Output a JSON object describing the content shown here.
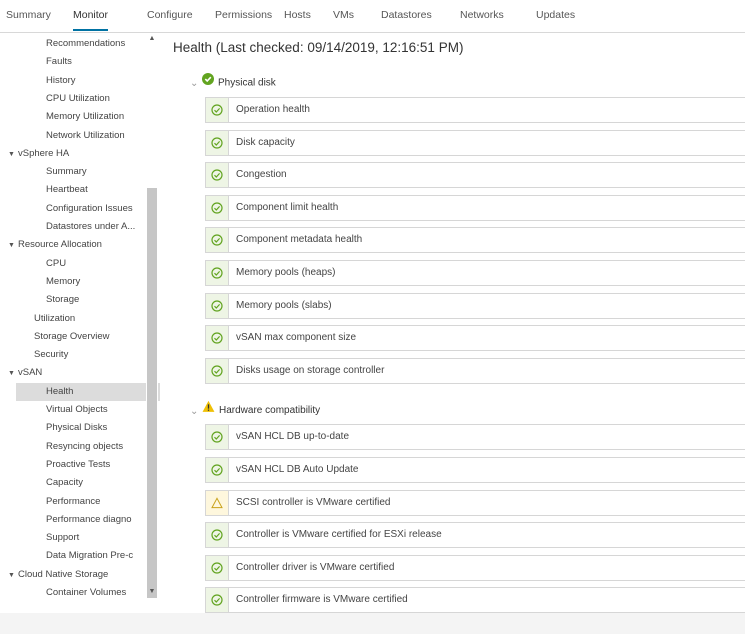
{
  "tabs": [
    "Summary",
    "Monitor",
    "Configure",
    "Permissions",
    "Hosts",
    "VMs",
    "Datastores",
    "Networks",
    "Updates"
  ],
  "active_tab": "Monitor",
  "sidebar": {
    "items": [
      {
        "label": "Recommendations",
        "level": 2,
        "caret": ""
      },
      {
        "label": "Faults",
        "level": 2,
        "caret": ""
      },
      {
        "label": "History",
        "level": 2,
        "caret": ""
      },
      {
        "label": "CPU Utilization",
        "level": 2,
        "caret": ""
      },
      {
        "label": "Memory Utilization",
        "level": 2,
        "caret": ""
      },
      {
        "label": "Network Utilization",
        "level": 2,
        "caret": ""
      },
      {
        "label": "vSphere HA",
        "level": 1,
        "caret": "▼"
      },
      {
        "label": "Summary",
        "level": 2,
        "caret": ""
      },
      {
        "label": "Heartbeat",
        "level": 2,
        "caret": ""
      },
      {
        "label": "Configuration Issues",
        "level": 2,
        "caret": ""
      },
      {
        "label": "Datastores under A...",
        "level": 2,
        "caret": ""
      },
      {
        "label": "Resource Allocation",
        "level": 1,
        "caret": "▼"
      },
      {
        "label": "CPU",
        "level": 2,
        "caret": ""
      },
      {
        "label": "Memory",
        "level": 2,
        "caret": ""
      },
      {
        "label": "Storage",
        "level": 2,
        "caret": ""
      },
      {
        "label": "Utilization",
        "level": 0,
        "caret": ""
      },
      {
        "label": "Storage Overview",
        "level": 0,
        "caret": ""
      },
      {
        "label": "Security",
        "level": 0,
        "caret": ""
      },
      {
        "label": "vSAN",
        "level": 1,
        "caret": "▼"
      },
      {
        "label": "Health",
        "level": 2,
        "caret": "",
        "selected": true
      },
      {
        "label": "Virtual Objects",
        "level": 2,
        "caret": ""
      },
      {
        "label": "Physical Disks",
        "level": 2,
        "caret": ""
      },
      {
        "label": "Resyncing objects",
        "level": 2,
        "caret": ""
      },
      {
        "label": "Proactive Tests",
        "level": 2,
        "caret": ""
      },
      {
        "label": "Capacity",
        "level": 2,
        "caret": ""
      },
      {
        "label": "Performance",
        "level": 2,
        "caret": ""
      },
      {
        "label": "Performance diagno",
        "level": 2,
        "caret": ""
      },
      {
        "label": "Support",
        "level": 2,
        "caret": ""
      },
      {
        "label": "Data Migration Pre-c",
        "level": 2,
        "caret": ""
      },
      {
        "label": "Cloud Native Storage",
        "level": 1,
        "caret": "▼"
      },
      {
        "label": "Container Volumes",
        "level": 2,
        "caret": ""
      }
    ]
  },
  "main": {
    "title": "Health (Last checked: 09/14/2019, 12:16:51 PM)",
    "sections": [
      {
        "title": "Physical disk",
        "status": "ok",
        "checks": [
          {
            "label": "Operation health",
            "status": "ok"
          },
          {
            "label": "Disk capacity",
            "status": "ok"
          },
          {
            "label": "Congestion",
            "status": "ok"
          },
          {
            "label": "Component limit health",
            "status": "ok"
          },
          {
            "label": "Component metadata health",
            "status": "ok"
          },
          {
            "label": "Memory pools (heaps)",
            "status": "ok"
          },
          {
            "label": "Memory pools (slabs)",
            "status": "ok"
          },
          {
            "label": "vSAN max component size",
            "status": "ok"
          },
          {
            "label": "Disks usage on storage controller",
            "status": "ok"
          }
        ]
      },
      {
        "title": "Hardware compatibility",
        "status": "warning",
        "checks": [
          {
            "label": "vSAN HCL DB up-to-date",
            "status": "ok"
          },
          {
            "label": "vSAN HCL DB Auto Update",
            "status": "ok"
          },
          {
            "label": "SCSI controller is VMware certified",
            "status": "warning"
          },
          {
            "label": "Controller is VMware certified for ESXi release",
            "status": "ok"
          },
          {
            "label": "Controller driver is VMware certified",
            "status": "ok"
          },
          {
            "label": "Controller firmware is VMware certified",
            "status": "ok"
          }
        ]
      }
    ]
  },
  "colors": {
    "accent": "#0072a3",
    "ok": "#62a420",
    "warning": "#efc006",
    "selected_bg": "#dcdcdc"
  },
  "icons": {
    "ok": "check-circle-icon",
    "warning": "warning-triangle-icon",
    "expand": "chevron-down-icon"
  }
}
